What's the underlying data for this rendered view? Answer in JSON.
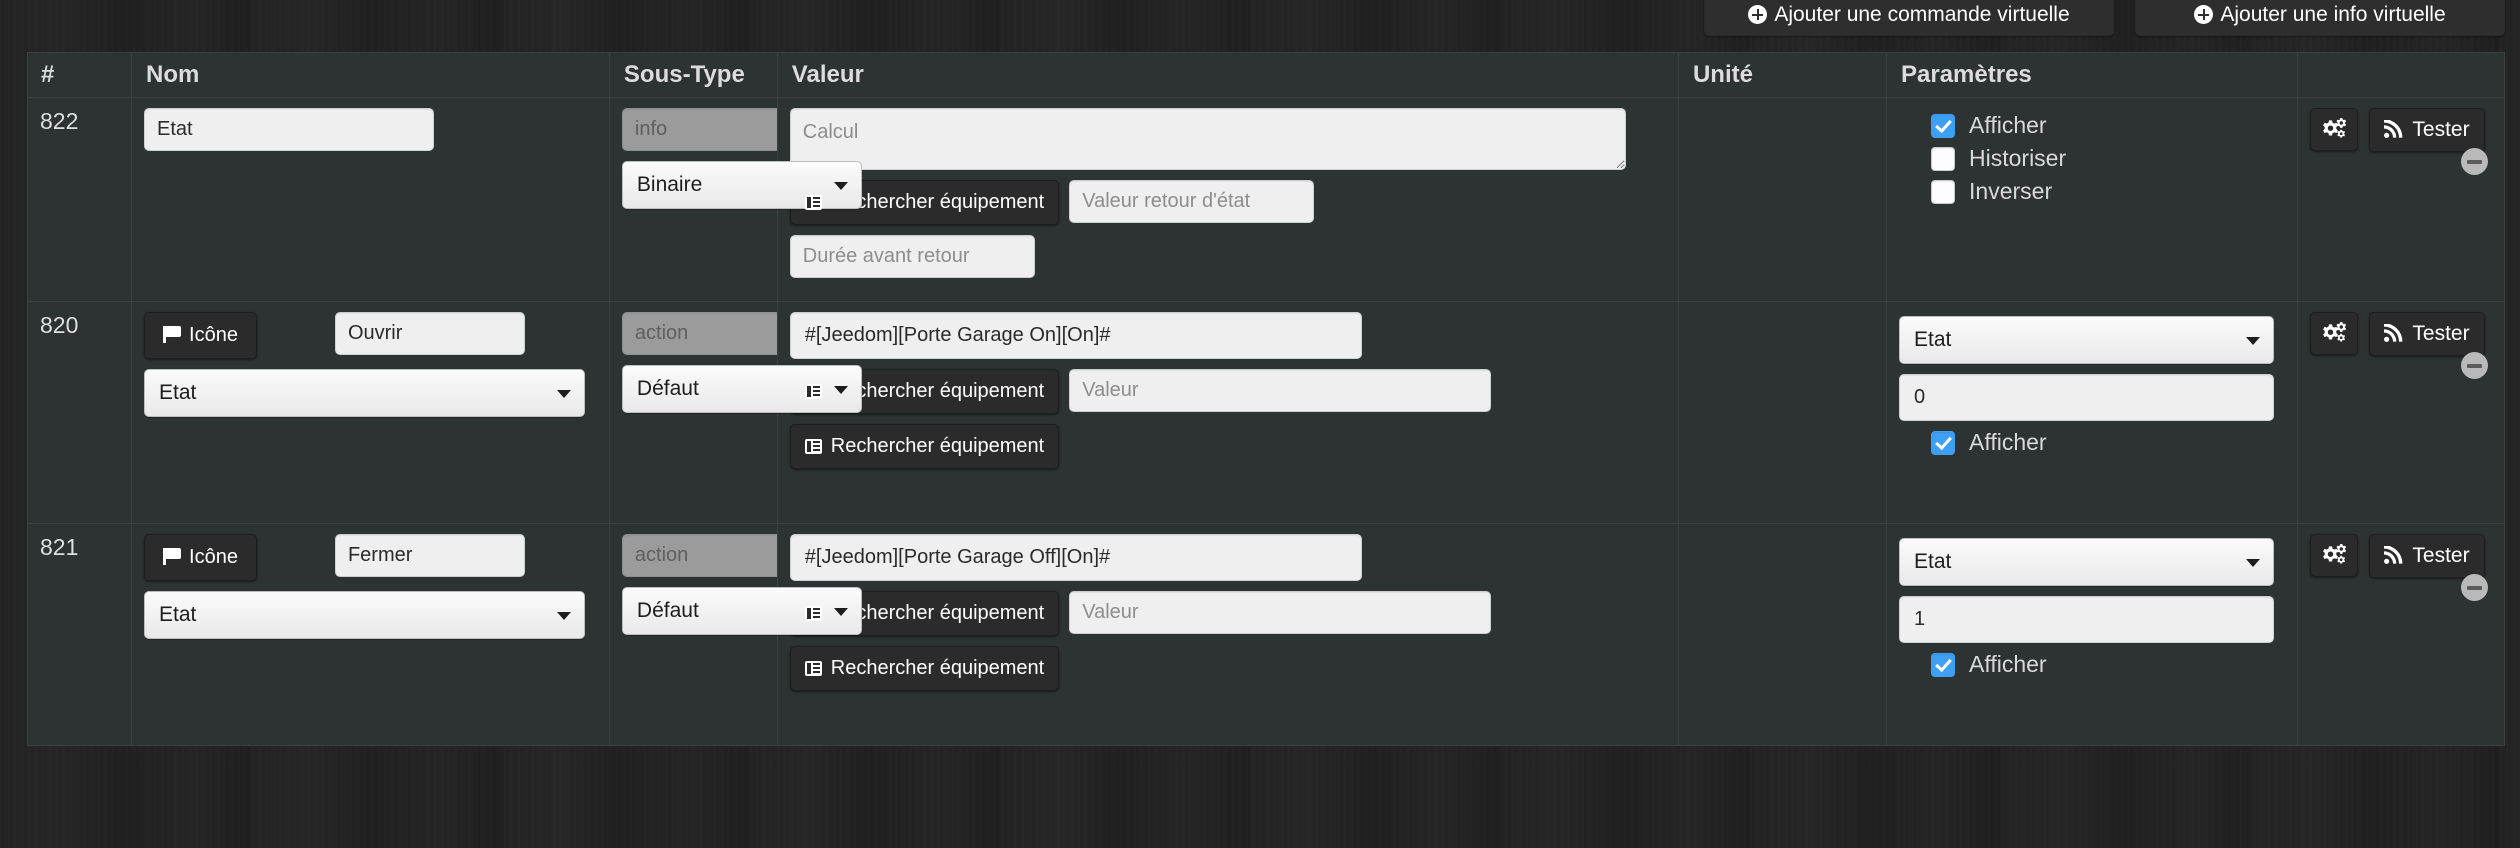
{
  "toolbar": {
    "add_command_label": "Ajouter une commande virtuelle",
    "add_info_label": "Ajouter une info virtuelle"
  },
  "table": {
    "headers": {
      "id": "#",
      "name": "Nom",
      "subtype": "Sous-Type",
      "value": "Valeur",
      "unit": "Unité",
      "params": "Paramètres",
      "actions": ""
    },
    "rows": [
      {
        "id": "822",
        "name_value": "Etat",
        "type_placeholder": "info",
        "subtype_selected": "Binaire",
        "value_placeholder": "Calcul",
        "value_text": "",
        "search_equipment_label": "Rechercher équipement",
        "state_return_placeholder": "Valeur retour d'état",
        "delay_placeholder": "Durée avant retour",
        "unit_value": "",
        "checkboxes": [
          {
            "label": "Afficher",
            "checked": true
          },
          {
            "label": "Historiser",
            "checked": false
          },
          {
            "label": "Inverser",
            "checked": false
          }
        ],
        "test_label": "Tester"
      },
      {
        "id": "820",
        "icon_label": "Icône",
        "name_value": "Ouvrir",
        "name_select": "Etat",
        "type_placeholder": "action",
        "subtype_selected": "Défaut",
        "value_text": "#[Jeedom][Porte Garage On][On]#",
        "search_equipment_label": "Rechercher équipement",
        "value_placeholder": "Valeur",
        "search_equipment_label_2": "Rechercher équipement",
        "unit_value": "",
        "param_select": "Etat",
        "param_value": "0",
        "checkboxes": [
          {
            "label": "Afficher",
            "checked": true
          }
        ],
        "test_label": "Tester"
      },
      {
        "id": "821",
        "icon_label": "Icône",
        "name_value": "Fermer",
        "name_select": "Etat",
        "type_placeholder": "action",
        "subtype_selected": "Défaut",
        "value_text": "#[Jeedom][Porte Garage Off][On]#",
        "search_equipment_label": "Rechercher équipement",
        "value_placeholder": "Valeur",
        "search_equipment_label_2": "Rechercher équipement",
        "unit_value": "",
        "param_select": "Etat",
        "param_value": "1",
        "checkboxes": [
          {
            "label": "Afficher",
            "checked": true
          }
        ],
        "test_label": "Tester"
      }
    ]
  },
  "colors": {
    "accent_checkbox": "#3da0f5",
    "table_bg": "#2d3232",
    "page_bg": "#232323",
    "button_dark": "#2b2b2b"
  }
}
